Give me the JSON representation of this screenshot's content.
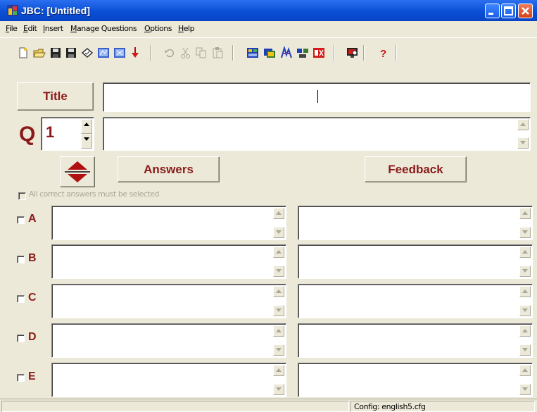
{
  "window": {
    "title": "JBC: [Untitled]"
  },
  "menu": [
    "File",
    "Edit",
    "Insert",
    "Manage Questions",
    "Options",
    "Help"
  ],
  "toolbar": {
    "icons": [
      "new-icon",
      "open-icon",
      "save-icon",
      "save-as-icon",
      "check-icon",
      "web-icon",
      "web-export-icon",
      "arrow-down-icon",
      "undo-icon",
      "cut-icon",
      "copy-icon",
      "paste-icon",
      "config-icon",
      "titles-icon",
      "appearance-icon",
      "buttons-icon",
      "prompts-icon",
      "monitor-icon",
      "help-icon"
    ]
  },
  "title_button": "Title",
  "title_value": "",
  "question": {
    "letter": "Q",
    "number": "1",
    "text": ""
  },
  "answers_button": "Answers",
  "feedback_button": "Feedback",
  "all_correct_label": "All correct answers must be selected",
  "rows": [
    {
      "label": "A",
      "answer": "",
      "feedback": ""
    },
    {
      "label": "B",
      "answer": "",
      "feedback": ""
    },
    {
      "label": "C",
      "answer": "",
      "feedback": ""
    },
    {
      "label": "D",
      "answer": "",
      "feedback": ""
    },
    {
      "label": "E",
      "answer": "",
      "feedback": ""
    }
  ],
  "status": {
    "config": "Config: english5.cfg"
  },
  "colors": {
    "accent": "#8b1a1a",
    "titlebar": "#0a4fd6",
    "face": "#ece9d8"
  }
}
